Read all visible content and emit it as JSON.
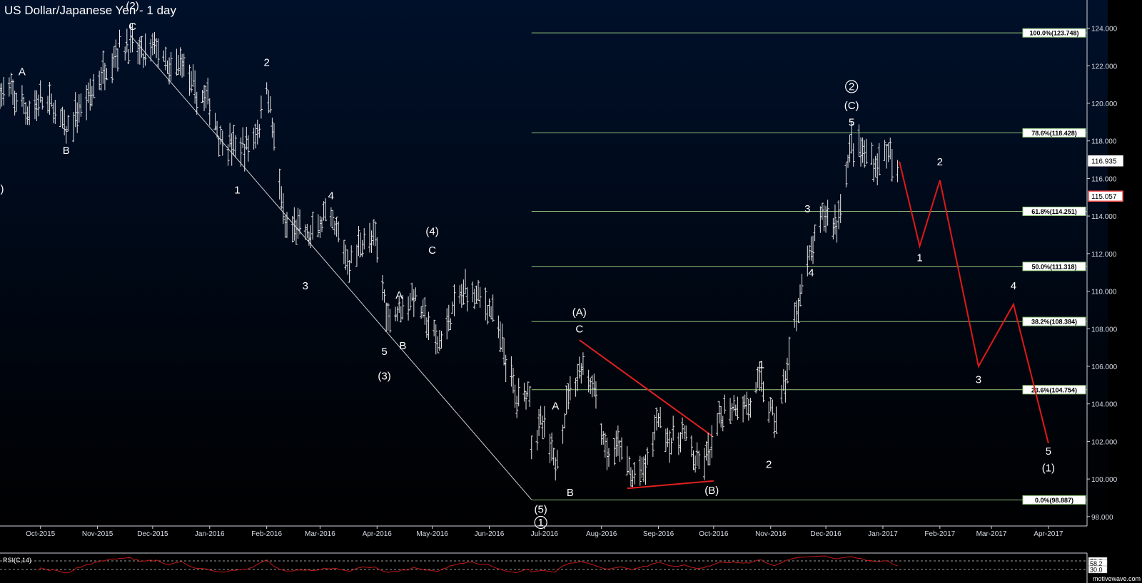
{
  "chart_data": {
    "type": "ohlc",
    "title": "US Dollar/Japanese Yen - 1 day",
    "ylim": [
      97.5,
      125.5
    ],
    "yticks": [
      98,
      100,
      102,
      104,
      106,
      108,
      110,
      112,
      114,
      116,
      118,
      120,
      122,
      124
    ],
    "ytick_labels": [
      "98.000",
      "100.000",
      "102.000",
      "104.000",
      "106.000",
      "108.000",
      "110.000",
      "112.000",
      "114.000",
      "116.000",
      "118.000",
      "120.000",
      "122.000",
      "124.000"
    ],
    "xlim": [
      "2015-09-09",
      "2017-04-22"
    ],
    "xticks": [
      {
        "date": "2015-10-01",
        "label": "Oct-2015"
      },
      {
        "date": "2015-11-01",
        "label": "Nov-2015"
      },
      {
        "date": "2015-12-01",
        "label": "Dec-2015"
      },
      {
        "date": "2016-01-01",
        "label": "Jan-2016"
      },
      {
        "date": "2016-02-01",
        "label": "Feb-2016"
      },
      {
        "date": "2016-03-01",
        "label": "Mar-2016"
      },
      {
        "date": "2016-04-01",
        "label": "Apr-2016"
      },
      {
        "date": "2016-05-01",
        "label": "May-2016"
      },
      {
        "date": "2016-06-01",
        "label": "Jun-2016"
      },
      {
        "date": "2016-07-01",
        "label": "Jul-2016"
      },
      {
        "date": "2016-08-01",
        "label": "Aug-2016"
      },
      {
        "date": "2016-09-01",
        "label": "Sep-2016"
      },
      {
        "date": "2016-10-01",
        "label": "Oct-2016"
      },
      {
        "date": "2016-11-01",
        "label": "Nov-2016"
      },
      {
        "date": "2016-12-01",
        "label": "Dec-2016"
      },
      {
        "date": "2017-01-01",
        "label": "Jan-2017"
      },
      {
        "date": "2017-02-01",
        "label": "Feb-2017"
      },
      {
        "date": "2017-03-01",
        "label": "Mar-2017"
      },
      {
        "date": "2017-04-01",
        "label": "Apr-2017"
      }
    ],
    "price_path": [
      [
        "2015-09-09",
        120.6
      ],
      [
        "2015-09-16",
        120.4
      ],
      [
        "2015-09-24",
        119.6
      ],
      [
        "2015-10-01",
        120.1
      ],
      [
        "2015-10-08",
        119.8
      ],
      [
        "2015-10-15",
        118.4
      ],
      [
        "2015-10-22",
        119.7
      ],
      [
        "2015-10-29",
        120.6
      ],
      [
        "2015-11-05",
        121.8
      ],
      [
        "2015-11-12",
        122.9
      ],
      [
        "2015-11-19",
        123.1
      ],
      [
        "2015-11-26",
        122.5
      ],
      [
        "2015-12-03",
        123.1
      ],
      [
        "2015-12-10",
        121.5
      ],
      [
        "2015-12-17",
        122.3
      ],
      [
        "2015-12-24",
        120.5
      ],
      [
        "2015-12-31",
        120.2
      ],
      [
        "2016-01-07",
        118.1
      ],
      [
        "2016-01-14",
        117.7
      ],
      [
        "2016-01-21",
        117.6
      ],
      [
        "2016-01-28",
        118.8
      ],
      [
        "2016-02-01",
        121.1
      ],
      [
        "2016-02-04",
        118.9
      ],
      [
        "2016-02-11",
        113.2
      ],
      [
        "2016-02-18",
        113.4
      ],
      [
        "2016-02-25",
        112.8
      ],
      [
        "2016-03-03",
        113.9
      ],
      [
        "2016-03-10",
        113.1
      ],
      [
        "2016-03-17",
        111.4
      ],
      [
        "2016-03-24",
        112.8
      ],
      [
        "2016-03-31",
        112.6
      ],
      [
        "2016-04-07",
        108.6
      ],
      [
        "2016-04-14",
        109.2
      ],
      [
        "2016-04-21",
        109.7
      ],
      [
        "2016-04-28",
        108.4
      ],
      [
        "2016-05-04",
        107.1
      ],
      [
        "2016-05-12",
        108.9
      ],
      [
        "2016-05-19",
        110.1
      ],
      [
        "2016-05-26",
        109.8
      ],
      [
        "2016-06-02",
        109.0
      ],
      [
        "2016-06-09",
        106.8
      ],
      [
        "2016-06-16",
        104.2
      ],
      [
        "2016-06-23",
        104.9
      ],
      [
        "2016-06-24",
        102.2
      ],
      [
        "2016-06-30",
        102.9
      ],
      [
        "2016-07-07",
        100.7
      ],
      [
        "2016-07-14",
        104.6
      ],
      [
        "2016-07-21",
        106.0
      ],
      [
        "2016-07-28",
        104.9
      ],
      [
        "2016-08-04",
        101.2
      ],
      [
        "2016-08-11",
        101.7
      ],
      [
        "2016-08-18",
        100.0
      ],
      [
        "2016-08-25",
        100.6
      ],
      [
        "2016-09-01",
        103.4
      ],
      [
        "2016-09-08",
        101.9
      ],
      [
        "2016-09-15",
        102.4
      ],
      [
        "2016-09-22",
        100.6
      ],
      [
        "2016-09-29",
        101.4
      ],
      [
        "2016-10-06",
        103.5
      ],
      [
        "2016-10-13",
        104.0
      ],
      [
        "2016-10-20",
        103.9
      ],
      [
        "2016-10-27",
        105.2
      ],
      [
        "2016-11-03",
        103.0
      ],
      [
        "2016-11-09",
        105.2
      ],
      [
        "2016-11-16",
        109.6
      ],
      [
        "2016-11-23",
        112.0
      ],
      [
        "2016-11-30",
        114.2
      ],
      [
        "2016-12-07",
        113.6
      ],
      [
        "2016-12-15",
        118.0
      ],
      [
        "2016-12-22",
        117.3
      ],
      [
        "2016-12-29",
        116.7
      ],
      [
        "2017-01-03",
        117.6
      ],
      [
        "2017-01-10",
        115.5
      ]
    ],
    "projection": [
      [
        "2017-01-10",
        116.9
      ],
      [
        "2017-01-21",
        112.4
      ],
      [
        "2017-02-01",
        115.9
      ],
      [
        "2017-02-22",
        106.0
      ],
      [
        "2017-03-13",
        109.3
      ],
      [
        "2017-04-01",
        101.9
      ]
    ],
    "fib_levels": [
      {
        "label": "100.0%(123.748)",
        "price": 123.748
      },
      {
        "label": "78.6%(118.428)",
        "price": 118.428
      },
      {
        "label": "61.8%(114.251)",
        "price": 114.251
      },
      {
        "label": "50.0%(111.318)",
        "price": 111.318
      },
      {
        "label": "38.2%(108.384)",
        "price": 108.384
      },
      {
        "label": "23.6%(104.754)",
        "price": 104.754
      },
      {
        "label": "0.0%(98.887)",
        "price": 98.887
      }
    ],
    "fib_start_date": "2016-06-24",
    "downtrend_line": [
      [
        "2015-11-19",
        123.6
      ],
      [
        "2016-06-24",
        98.9
      ]
    ],
    "triangle_lines": [
      [
        [
          "2016-07-20",
          107.4
        ],
        [
          "2016-09-30",
          102.3
        ]
      ],
      [
        [
          "2016-08-15",
          99.5
        ],
        [
          "2016-10-01",
          99.9
        ]
      ]
    ],
    "price_tags": [
      {
        "label": "116.935",
        "price": 116.935,
        "color": "#ffffff"
      },
      {
        "label": "115.057",
        "price": 115.057,
        "color": "#ff5a5a"
      }
    ],
    "wave_labels": [
      {
        "text": "(2)",
        "date": "2015-11-20",
        "price": 125.0
      },
      {
        "text": "C",
        "date": "2015-11-20",
        "price": 123.9
      },
      {
        "text": "A",
        "date": "2015-09-21",
        "price": 121.5
      },
      {
        "text": "B",
        "date": "2015-10-15",
        "price": 117.3
      },
      {
        "text": "2",
        "date": "2016-02-01",
        "price": 122.0
      },
      {
        "text": "1",
        "date": "2016-01-16",
        "price": 115.2
      },
      {
        "text": "4",
        "date": "2016-03-07",
        "price": 114.9
      },
      {
        "text": "3",
        "date": "2016-02-22",
        "price": 110.1
      },
      {
        "text": "(4)",
        "date": "2016-05-01",
        "price": 113.0
      },
      {
        "text": "C",
        "date": "2016-05-01",
        "price": 112.0
      },
      {
        "text": "A",
        "date": "2016-04-13",
        "price": 109.6
      },
      {
        "text": "5",
        "date": "2016-04-05",
        "price": 106.6
      },
      {
        "text": "B",
        "date": "2016-04-15",
        "price": 106.9
      },
      {
        "text": "(3)",
        "date": "2016-04-05",
        "price": 105.3
      },
      {
        "text": "(5)",
        "date": "2016-06-29",
        "price": 98.2
      },
      {
        "text": "A",
        "date": "2016-07-07",
        "price": 103.7
      },
      {
        "text": "B",
        "date": "2016-07-15",
        "price": 99.1
      },
      {
        "text": "(A)",
        "date": "2016-07-20",
        "price": 108.7
      },
      {
        "text": "C",
        "date": "2016-07-20",
        "price": 107.8
      },
      {
        "text": "(B)",
        "date": "2016-09-30",
        "price": 99.2
      },
      {
        "text": "1",
        "date": "2016-10-27",
        "price": 105.9
      },
      {
        "text": "2",
        "date": "2016-10-31",
        "price": 100.6
      },
      {
        "text": "3",
        "date": "2016-11-21",
        "price": 114.2
      },
      {
        "text": "4",
        "date": "2016-11-23",
        "price": 110.8
      },
      {
        "text": "(C)",
        "date": "2016-12-15",
        "price": 119.7
      },
      {
        "text": "5",
        "date": "2016-12-15",
        "price": 118.8
      },
      {
        "text": "1",
        "date": "2017-01-21",
        "price": 111.6
      },
      {
        "text": "2",
        "date": "2017-02-01",
        "price": 116.7
      },
      {
        "text": "3",
        "date": "2017-02-22",
        "price": 105.1
      },
      {
        "text": "4",
        "date": "2017-03-13",
        "price": 110.1
      },
      {
        "text": "5",
        "date": "2017-04-01",
        "price": 101.3
      },
      {
        "text": "(1)",
        "date": "2017-04-01",
        "price": 100.4
      }
    ],
    "circled_labels": [
      {
        "text": "1",
        "date": "2016-06-29",
        "price": 97.5
      },
      {
        "text": "2",
        "date": "2016-12-15",
        "price": 120.7
      }
    ],
    "left_edge_label": ")",
    "rsi": {
      "label": "RSI(C,14)",
      "period": 14,
      "levels": [
        70.0,
        30.0
      ],
      "level_labels": [
        "70.0",
        "30.0"
      ],
      "last": 58.2,
      "last_label": "58.2"
    },
    "watermark": "motivewave.com",
    "colors": {
      "background_top": "#00102a",
      "background_bottom": "#000000",
      "candles": "#e6e6e6",
      "fib_lines": "#8fc47a",
      "fib_tag_bg": "#ffffff",
      "downtrend_line": "#d0d0d0",
      "triangle": "#e02020",
      "projection": "#e01818",
      "rsi_line": "#c01818",
      "axis_text": "#d8dde6"
    }
  }
}
